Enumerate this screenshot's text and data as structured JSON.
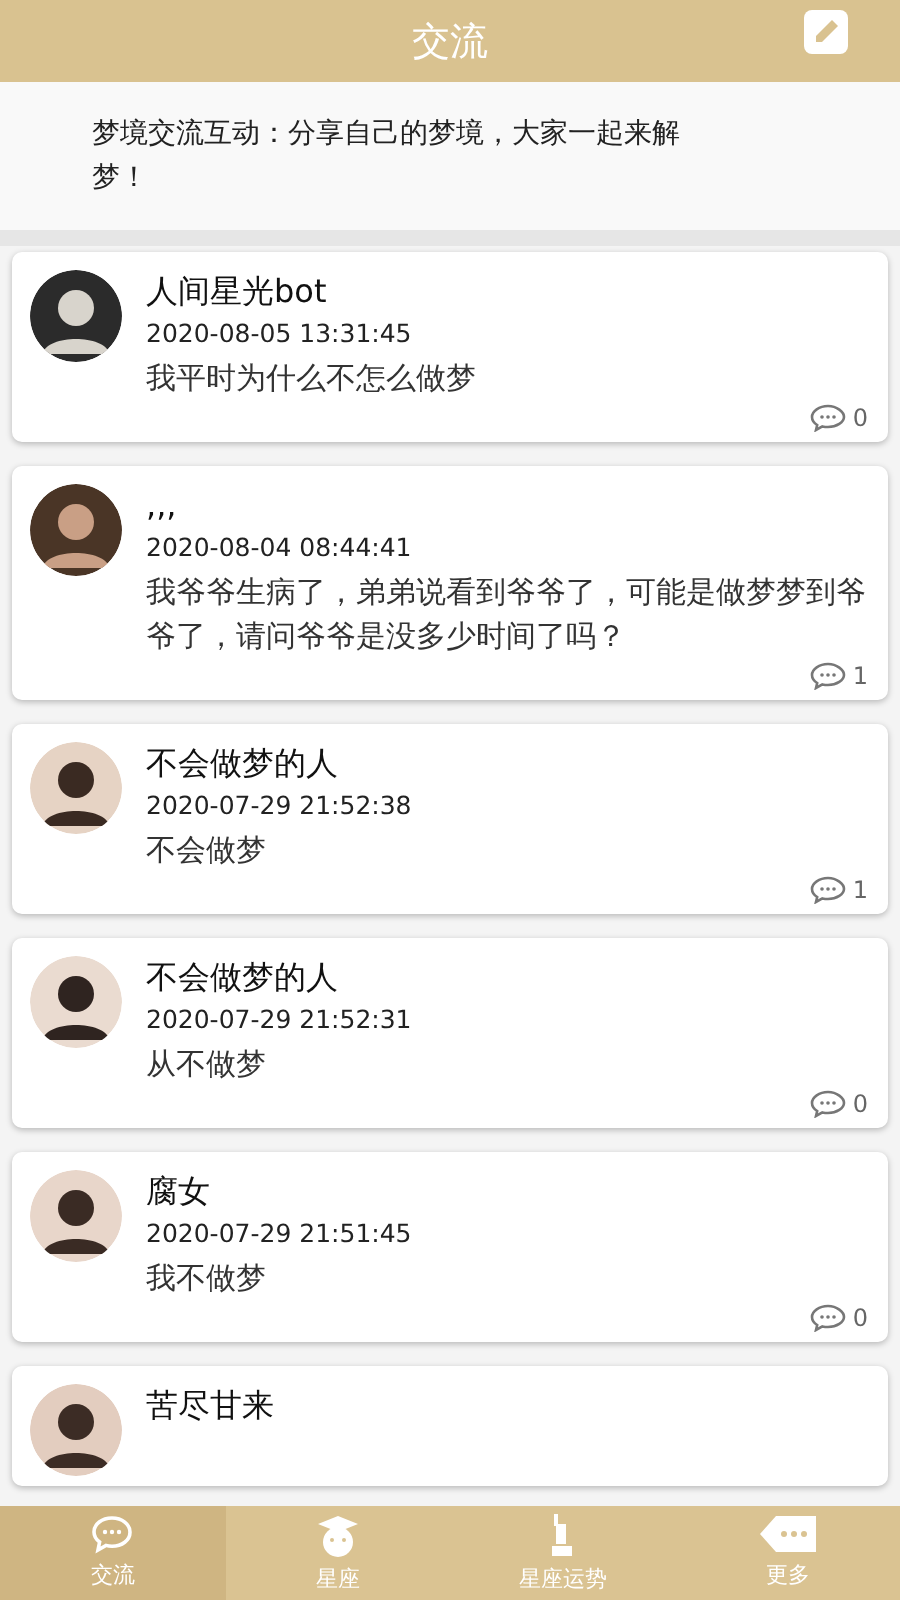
{
  "header": {
    "title": "交流"
  },
  "intro": "梦境交流互动：分享自己的梦境，大家一起来解梦！",
  "posts": [
    {
      "author": "人间星光bot",
      "time": "2020-08-05 13:31:45",
      "content": "我平时为什么不怎么做梦",
      "comments": "0"
    },
    {
      "author": ",,,",
      "time": "2020-08-04 08:44:41",
      "content": "我爷爷生病了，弟弟说看到爷爷了，可能是做梦梦到爷爷了，请问爷爷是没多少时间了吗？",
      "comments": "1"
    },
    {
      "author": "不会做梦的人",
      "time": "2020-07-29 21:52:38",
      "content": "不会做梦",
      "comments": "1"
    },
    {
      "author": "不会做梦的人",
      "time": "2020-07-29 21:52:31",
      "content": "从不做梦",
      "comments": "0"
    },
    {
      "author": "腐女",
      "time": "2020-07-29 21:51:45",
      "content": "我不做梦",
      "comments": "0"
    },
    {
      "author": "苦尽甘来"
    }
  ],
  "tabs": [
    {
      "label": "交流",
      "kind": "chat",
      "selected": true
    },
    {
      "label": "星座",
      "kind": "scholar",
      "selected": false
    },
    {
      "label": "星座运势",
      "kind": "statue",
      "selected": false
    },
    {
      "label": "更多",
      "kind": "more",
      "selected": false
    }
  ]
}
